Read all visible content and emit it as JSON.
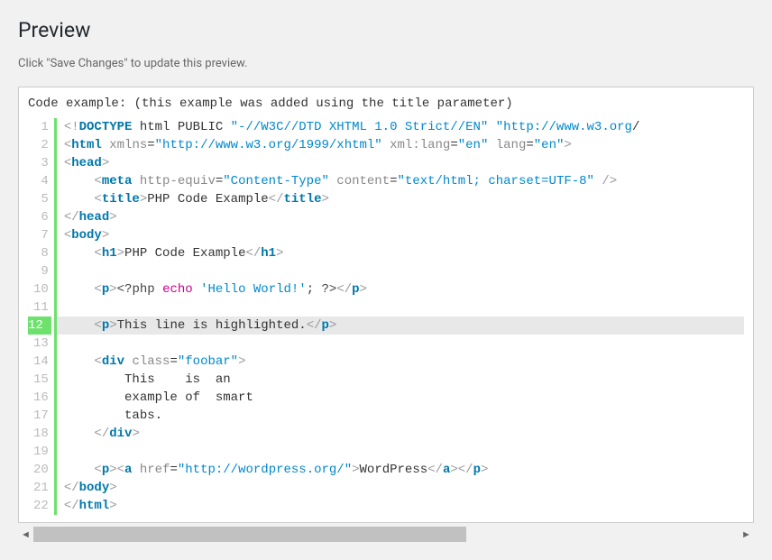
{
  "heading": "Preview",
  "instruction": "Click \"Save Changes\" to update this preview.",
  "code_title": "Code example: (this example was added using the title parameter)",
  "line_count": 22,
  "highlighted_line": 12,
  "code_lines": [
    [
      [
        "t-gray",
        "<!"
      ],
      [
        "t-tag",
        "DOCTYPE"
      ],
      [
        "t-txt",
        " html PUBLIC "
      ],
      [
        "t-str",
        "\"-//W3C//DTD XHTML 1.0 Strict//EN\""
      ],
      [
        "t-txt",
        " "
      ],
      [
        "t-str",
        "\"http://www.w3.org"
      ],
      [
        "t-txt",
        "/"
      ]
    ],
    [
      [
        "t-gray",
        "<"
      ],
      [
        "t-tag",
        "html"
      ],
      [
        "t-txt",
        " "
      ],
      [
        "t-attr",
        "xmlns"
      ],
      [
        "t-txt",
        "="
      ],
      [
        "t-str",
        "\"http://www.w3.org/1999/xhtml\""
      ],
      [
        "t-txt",
        " "
      ],
      [
        "t-attr",
        "xml:lang"
      ],
      [
        "t-txt",
        "="
      ],
      [
        "t-str",
        "\"en\""
      ],
      [
        "t-txt",
        " "
      ],
      [
        "t-attr",
        "lang"
      ],
      [
        "t-txt",
        "="
      ],
      [
        "t-str",
        "\"en\""
      ],
      [
        "t-gray",
        ">"
      ]
    ],
    [
      [
        "t-gray",
        "<"
      ],
      [
        "t-tag",
        "head"
      ],
      [
        "t-gray",
        ">"
      ]
    ],
    [
      [
        "t-txt",
        "    "
      ],
      [
        "t-gray",
        "<"
      ],
      [
        "t-tag",
        "meta"
      ],
      [
        "t-txt",
        " "
      ],
      [
        "t-attr",
        "http-equiv"
      ],
      [
        "t-txt",
        "="
      ],
      [
        "t-str",
        "\"Content-Type\""
      ],
      [
        "t-txt",
        " "
      ],
      [
        "t-attr",
        "content"
      ],
      [
        "t-txt",
        "="
      ],
      [
        "t-str",
        "\"text/html; charset=UTF-8\""
      ],
      [
        "t-txt",
        " "
      ],
      [
        "t-gray",
        "/>"
      ]
    ],
    [
      [
        "t-txt",
        "    "
      ],
      [
        "t-gray",
        "<"
      ],
      [
        "t-tag",
        "title"
      ],
      [
        "t-gray",
        ">"
      ],
      [
        "t-txt",
        "PHP Code Example"
      ],
      [
        "t-gray",
        "</"
      ],
      [
        "t-tag",
        "title"
      ],
      [
        "t-gray",
        ">"
      ]
    ],
    [
      [
        "t-gray",
        "</"
      ],
      [
        "t-tag",
        "head"
      ],
      [
        "t-gray",
        ">"
      ]
    ],
    [
      [
        "t-gray",
        "<"
      ],
      [
        "t-tag",
        "body"
      ],
      [
        "t-gray",
        ">"
      ]
    ],
    [
      [
        "t-txt",
        "    "
      ],
      [
        "t-gray",
        "<"
      ],
      [
        "t-tag",
        "h1"
      ],
      [
        "t-gray",
        ">"
      ],
      [
        "t-txt",
        "PHP Code Example"
      ],
      [
        "t-gray",
        "</"
      ],
      [
        "t-tag",
        "h1"
      ],
      [
        "t-gray",
        ">"
      ]
    ],
    [
      [
        "t-txt",
        " "
      ]
    ],
    [
      [
        "t-txt",
        "    "
      ],
      [
        "t-gray",
        "<"
      ],
      [
        "t-tag",
        "p"
      ],
      [
        "t-gray",
        ">"
      ],
      [
        "t-phpq",
        "<?php "
      ],
      [
        "t-echo",
        "echo"
      ],
      [
        "t-txt",
        " "
      ],
      [
        "t-sq",
        "'Hello World!'"
      ],
      [
        "t-txt",
        "; "
      ],
      [
        "t-phpq",
        "?>"
      ],
      [
        "t-gray",
        "</"
      ],
      [
        "t-tag",
        "p"
      ],
      [
        "t-gray",
        ">"
      ]
    ],
    [
      [
        "t-txt",
        " "
      ]
    ],
    [
      [
        "t-txt",
        "    "
      ],
      [
        "t-gray",
        "<"
      ],
      [
        "t-tag",
        "p"
      ],
      [
        "t-gray",
        ">"
      ],
      [
        "t-txt",
        "This line is highlighted."
      ],
      [
        "t-gray",
        "</"
      ],
      [
        "t-tag",
        "p"
      ],
      [
        "t-gray",
        ">"
      ]
    ],
    [
      [
        "t-txt",
        " "
      ]
    ],
    [
      [
        "t-txt",
        "    "
      ],
      [
        "t-gray",
        "<"
      ],
      [
        "t-tag",
        "div"
      ],
      [
        "t-txt",
        " "
      ],
      [
        "t-attr",
        "class"
      ],
      [
        "t-txt",
        "="
      ],
      [
        "t-str",
        "\"foobar\""
      ],
      [
        "t-gray",
        ">"
      ]
    ],
    [
      [
        "t-txt",
        "        This    is  an"
      ]
    ],
    [
      [
        "t-txt",
        "        example of  smart"
      ]
    ],
    [
      [
        "t-txt",
        "        tabs."
      ]
    ],
    [
      [
        "t-txt",
        "    "
      ],
      [
        "t-gray",
        "</"
      ],
      [
        "t-tag",
        "div"
      ],
      [
        "t-gray",
        ">"
      ]
    ],
    [
      [
        "t-txt",
        " "
      ]
    ],
    [
      [
        "t-txt",
        "    "
      ],
      [
        "t-gray",
        "<"
      ],
      [
        "t-tag",
        "p"
      ],
      [
        "t-gray",
        ">"
      ],
      [
        "t-gray",
        "<"
      ],
      [
        "t-tag",
        "a"
      ],
      [
        "t-txt",
        " "
      ],
      [
        "t-attr",
        "href"
      ],
      [
        "t-txt",
        "="
      ],
      [
        "t-str",
        "\"http://wordpress.org/\""
      ],
      [
        "t-gray",
        ">"
      ],
      [
        "t-txt",
        "WordPress"
      ],
      [
        "t-gray",
        "</"
      ],
      [
        "t-tag",
        "a"
      ],
      [
        "t-gray",
        ">"
      ],
      [
        "t-gray",
        "</"
      ],
      [
        "t-tag",
        "p"
      ],
      [
        "t-gray",
        ">"
      ]
    ],
    [
      [
        "t-gray",
        "</"
      ],
      [
        "t-tag",
        "body"
      ],
      [
        "t-gray",
        ">"
      ]
    ],
    [
      [
        "t-gray",
        "</"
      ],
      [
        "t-tag",
        "html"
      ],
      [
        "t-gray",
        ">"
      ]
    ]
  ],
  "scroll_arrows": {
    "left": "◄",
    "right": "►"
  }
}
